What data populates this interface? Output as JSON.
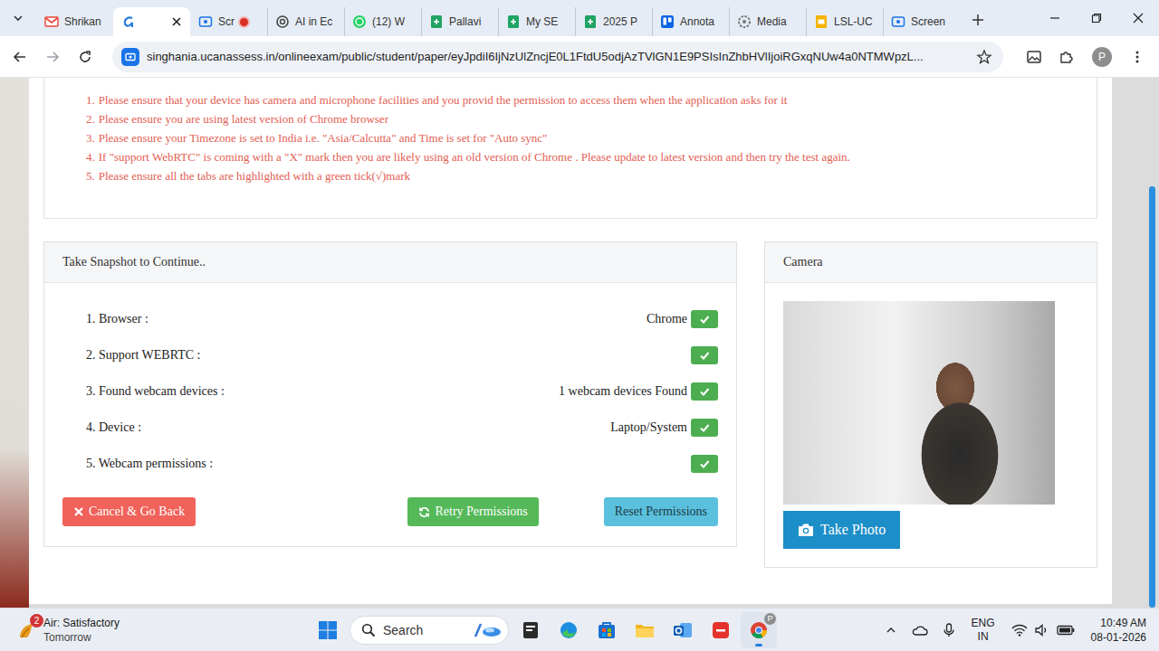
{
  "browser": {
    "tabs": [
      {
        "label": "Shrikan",
        "kind": "gmail",
        "selected": false,
        "recording": false
      },
      {
        "kind": "ucan",
        "selected": true,
        "recording": false
      },
      {
        "label": "Scr",
        "kind": "screencast",
        "selected": false,
        "recording": true
      },
      {
        "label": "AI in Ec",
        "kind": "chatgpt",
        "selected": false,
        "recording": false
      },
      {
        "label": "(12) W",
        "kind": "whatsapp",
        "selected": false,
        "recording": false
      },
      {
        "label": "Pallavi",
        "kind": "sheets",
        "selected": false,
        "recording": false
      },
      {
        "label": "My SE",
        "kind": "sheets",
        "selected": false,
        "recording": false
      },
      {
        "label": "2025 P",
        "kind": "sheets",
        "selected": false,
        "recording": false
      },
      {
        "label": "Annota",
        "kind": "trello",
        "selected": false,
        "recording": false
      },
      {
        "label": "Media",
        "kind": "media",
        "selected": false,
        "recording": false
      },
      {
        "label": "LSL-UC",
        "kind": "slides",
        "selected": false,
        "recording": false
      },
      {
        "label": "Screen",
        "kind": "screencast",
        "selected": false,
        "recording": false
      }
    ],
    "address": "singhania.ucanassess.in/onlineexam/public/student/paper/eyJpdiI6IjNzUlZncjE0L1FtdU5odjAzTVlGN1E9PSIsInZhbHVlIjoiRGxqNUw4a0NTMWpzL...",
    "profile": "P"
  },
  "instructions": [
    {
      "number": "1.",
      "text": "Please ensure that your device has camera and microphone facilities and you provid the permission to access them when the application asks for it"
    },
    {
      "number": "2.",
      "text": "Please ensure you are using latest version of Chrome browser"
    },
    {
      "number": "3.",
      "text": "Please ensure your Timezone is set to India i.e. \"Asia/Calcutta\" and Time is set for \"Auto sync\""
    },
    {
      "number": "4.",
      "text": "If \"support WebRTC\" is coming with a \"X\" mark then you are likely using an old version of Chrome . Please update to latest version and then try the test again."
    },
    {
      "number": "5.",
      "text": "Please ensure all the tabs are highlighted with a green tick(√)mark"
    }
  ],
  "checks": {
    "title": "Take Snapshot to Continue..",
    "rows": [
      {
        "label": "1. Browser :",
        "value": "Chrome",
        "ok": true
      },
      {
        "label": "2. Support WEBRTC :",
        "ok": true
      },
      {
        "label": "3. Found webcam devices :",
        "value": "1 webcam devices Found",
        "ok": true
      },
      {
        "label": "4. Device :",
        "value": "Laptop/System",
        "ok": true
      },
      {
        "label": "5. Webcam permissions :",
        "ok": true
      }
    ],
    "buttons": [
      {
        "label": "Cancel & Go Back",
        "kind": "cancel",
        "color": "#f0625a"
      },
      {
        "label": "Retry Permissions",
        "kind": "retry",
        "color": "#55b95a"
      },
      {
        "label": "Reset Permissions",
        "kind": "reset",
        "color": "#5bc0de"
      }
    ]
  },
  "camera": {
    "title": "Camera",
    "button": "Take Photo"
  },
  "taskbar": {
    "weather": {
      "badge": "2",
      "title": "Air: Satisfactory",
      "subtitle": "Tomorrow"
    },
    "search": "Search",
    "apps": [
      {
        "kind": "files",
        "active": false
      },
      {
        "kind": "edge",
        "active": false
      },
      {
        "kind": "store",
        "active": false
      },
      {
        "kind": "explorer",
        "active": false
      },
      {
        "kind": "outlook",
        "active": false
      },
      {
        "kind": "wps",
        "active": false
      },
      {
        "kind": "chrome",
        "active": true,
        "badge": "P"
      }
    ],
    "language": "ENG",
    "region": "IN",
    "time": "10:49 AM",
    "date": "08-01-2026"
  }
}
